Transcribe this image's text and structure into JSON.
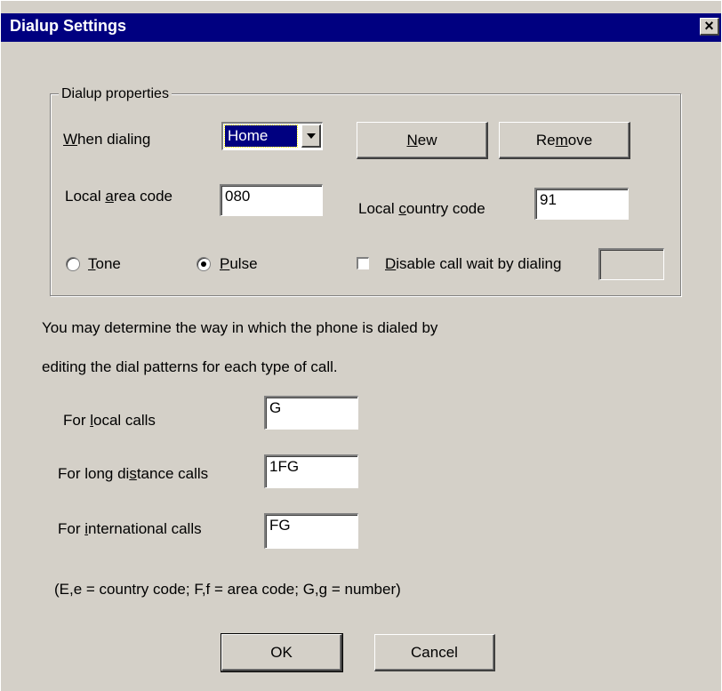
{
  "window": {
    "title": "Dialup Settings",
    "close_glyph": "×"
  },
  "group": {
    "label": "Dialup properties"
  },
  "when_dialing": {
    "label_pre": "",
    "label_ul": "W",
    "label_post": "hen dialing",
    "selected": "Home"
  },
  "buttons": {
    "new_pre": "",
    "new_ul": "N",
    "new_post": "ew",
    "remove_pre": "Re",
    "remove_ul": "m",
    "remove_post": "ove",
    "ok": "OK",
    "cancel": "Cancel"
  },
  "area_code": {
    "label_pre": "Local ",
    "label_ul": "a",
    "label_post": "rea code",
    "value": "080"
  },
  "country_code": {
    "label_pre": "Local ",
    "label_ul": "c",
    "label_post": "ountry code",
    "value": "91"
  },
  "dial_mode": {
    "tone_pre": "",
    "tone_ul": "T",
    "tone_post": "one",
    "pulse_pre": "",
    "pulse_ul": "P",
    "pulse_post": "ulse",
    "selected": "Pulse"
  },
  "call_wait": {
    "label_pre": "",
    "label_ul": "D",
    "label_post": "isable call wait by dialing",
    "value": "",
    "checked": false
  },
  "info_line1": "You may determine the way in which the phone is dialed by",
  "info_line2": "editing the dial patterns for each type of call.",
  "patterns": {
    "local": {
      "label_pre": "For ",
      "label_ul": "l",
      "label_post": "ocal calls",
      "value": "G"
    },
    "long": {
      "label_pre": "For long di",
      "label_ul": "s",
      "label_post": "tance calls",
      "value": "1FG"
    },
    "intl": {
      "label_pre": "For ",
      "label_ul": "i",
      "label_post": "nternational calls",
      "value": "FG"
    }
  },
  "legend": "(E,e = country code; F,f = area code; G,g = number)"
}
